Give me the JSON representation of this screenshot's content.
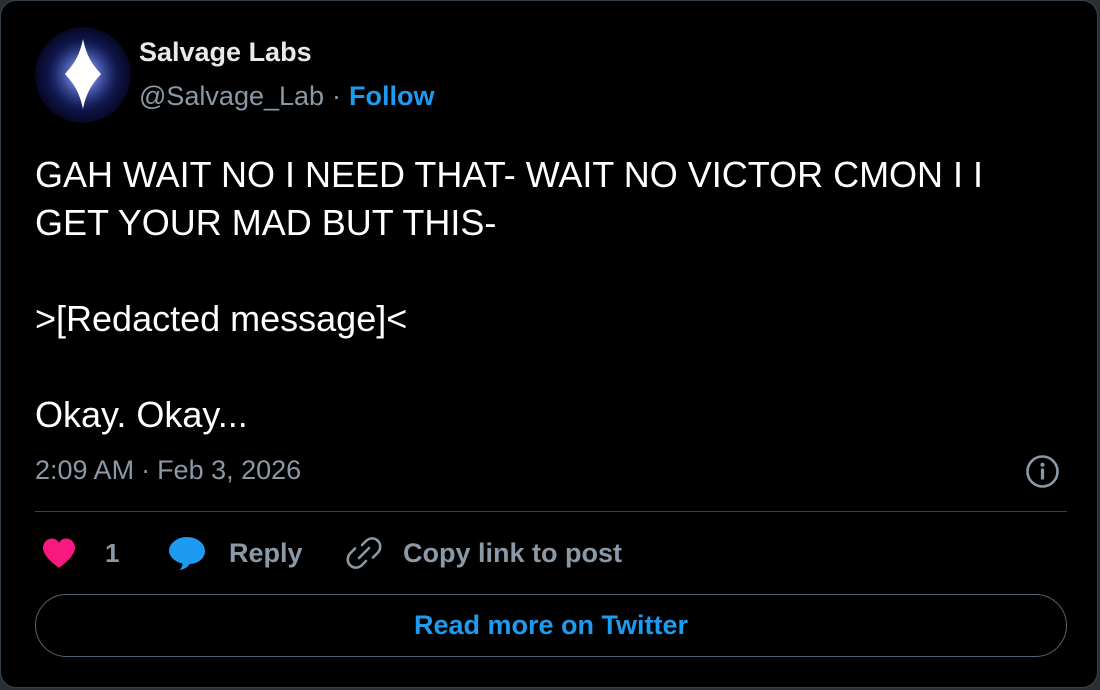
{
  "author": {
    "name": "Salvage Labs",
    "handle": "@Salvage_Lab",
    "separator": "·",
    "follow_label": "Follow",
    "avatar_icon": "diamond-star-icon"
  },
  "tweet": {
    "lines": [
      "GAH WAIT NO I NEED THAT- WAIT NO VICTOR CMON I I GET YOUR MAD BUT THIS-",
      ">[Redacted message]<",
      "Okay. Okay..."
    ],
    "time": "2:09 AM",
    "separator": "·",
    "date": "Feb 3, 2026"
  },
  "actions": {
    "like_count": "1",
    "reply_label": "Reply",
    "copy_link_label": "Copy link to post",
    "info_icon": "info-icon"
  },
  "footer": {
    "read_more_label": "Read more on Twitter"
  },
  "colors": {
    "background": "#000000",
    "accent": "#1d9bf0",
    "secondary_text": "#8b98a5",
    "like": "#f91880",
    "border": "#38444d"
  }
}
